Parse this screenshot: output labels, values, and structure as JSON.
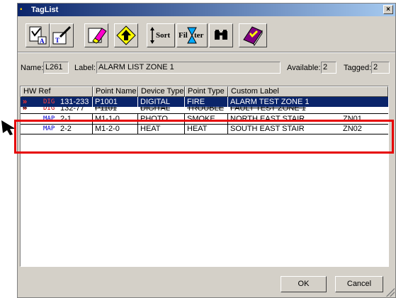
{
  "window": {
    "title": "TagList",
    "close_glyph": "×"
  },
  "toolbar": {
    "icons": [
      "tag-select-icon",
      "tag-edit-icon",
      "tag-erase-icon",
      "up-arrow-icon",
      "sort-icon",
      "filter-icon",
      "binoculars-icon",
      "book-icon"
    ],
    "sort_label": "Sort",
    "filter_label_left": "Fil",
    "filter_label_right": "ter"
  },
  "info": {
    "name_label": "Name:",
    "name_value": "L261",
    "label_label": "Label:",
    "label_value": "ALARM LIST ZONE 1",
    "available_label": "Available:",
    "available_value": "2",
    "tagged_label": "Tagged:",
    "tagged_value": "2"
  },
  "table": {
    "headers": [
      "HW Ref",
      "Point Name",
      "Device Type",
      "Point Type",
      "Custom Label"
    ],
    "rows": [
      {
        "marker": "»",
        "tag": "DIG",
        "hwref": "131-233",
        "point_name": "P1001",
        "device_type": "DIGITAL",
        "point_type": "FIRE",
        "custom_label": "ALARM TEST ZONE 1",
        "zone": "",
        "selected": true,
        "struck": false
      },
      {
        "marker": "»",
        "tag": "DIG",
        "hwref": "132-77",
        "point_name": "P1101",
        "device_type": "DIGITAL",
        "point_type": "TROUBLE",
        "custom_label": "FAULT TEST ZONE 1",
        "zone": "",
        "selected": false,
        "struck": true
      },
      {
        "marker": "",
        "tag": "MAP",
        "hwref": "2-1",
        "point_name": "M1-1-0",
        "device_type": "PHOTO",
        "point_type": "SMOKE",
        "custom_label": "NORTH EAST STAIR",
        "zone": "ZN01",
        "selected": false,
        "struck": false
      },
      {
        "marker": "",
        "tag": "MAP",
        "hwref": "2-2",
        "point_name": "M1-2-0",
        "device_type": "HEAT",
        "point_type": "HEAT",
        "custom_label": "SOUTH EAST STAIR",
        "zone": "ZN02",
        "selected": false,
        "struck": false
      }
    ]
  },
  "buttons": {
    "ok": "OK",
    "cancel": "Cancel"
  },
  "colors": {
    "highlight_box": "#e60000",
    "selection": "#0a246a",
    "tag_dig": "#cc0000",
    "tag_map": "#0000cc"
  }
}
